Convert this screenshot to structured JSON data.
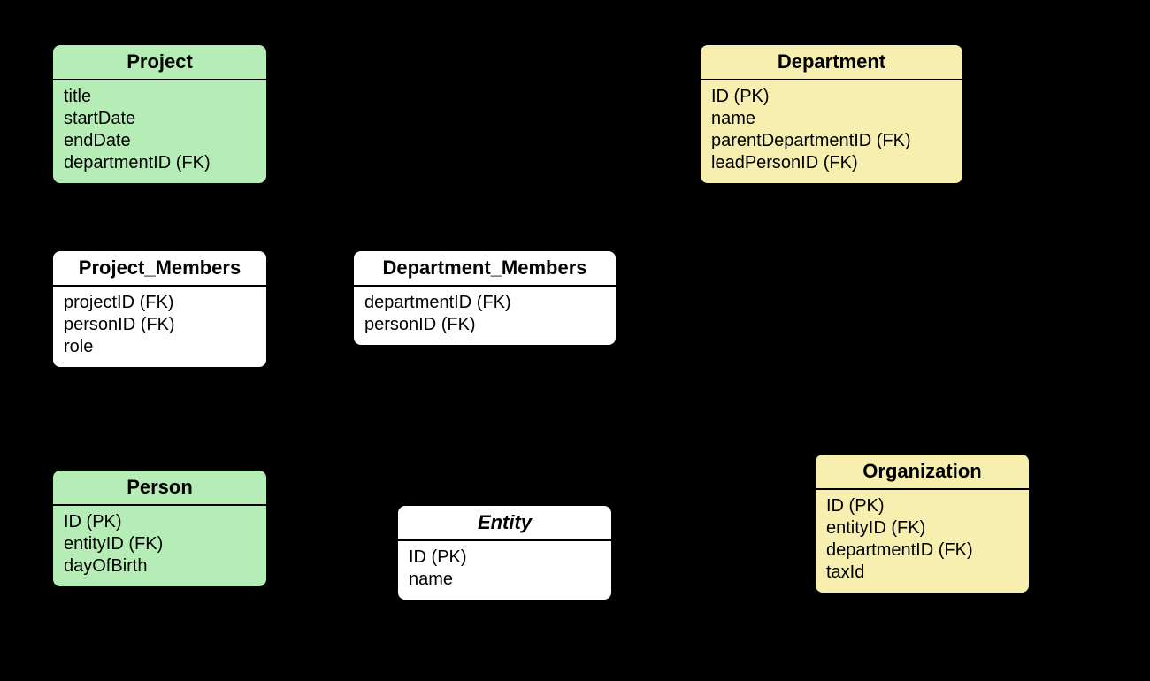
{
  "colors": {
    "green": "#b6ecb6",
    "yellow": "#f6efb0",
    "white": "#ffffff",
    "bg": "#000000"
  },
  "entities": {
    "project": {
      "title": "Project",
      "attrs": [
        "title",
        "startDate",
        "endDate",
        "departmentID (FK)"
      ]
    },
    "department": {
      "title": "Department",
      "attrs": [
        "ID (PK)",
        "name",
        "parentDepartmentID (FK)",
        "leadPersonID (FK)"
      ]
    },
    "project_members": {
      "title": "Project_Members",
      "attrs": [
        "projectID (FK)",
        "personID (FK)",
        "role"
      ]
    },
    "department_members": {
      "title": "Department_Members",
      "attrs": [
        "departmentID (FK)",
        "personID (FK)"
      ]
    },
    "person": {
      "title": "Person",
      "attrs": [
        "ID (PK)",
        "entityID (FK)",
        "dayOfBirth"
      ]
    },
    "entity": {
      "title": "Entity",
      "attrs": [
        "ID (PK)",
        "name"
      ]
    },
    "organization": {
      "title": "Organization",
      "attrs": [
        "ID (PK)",
        "entityID (FK)",
        "departmentID (FK)",
        "taxId"
      ]
    }
  }
}
